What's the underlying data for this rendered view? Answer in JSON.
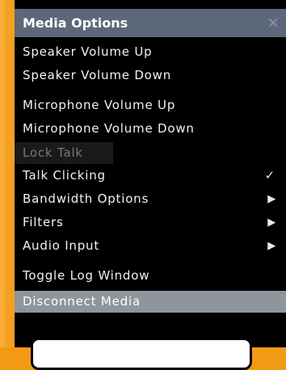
{
  "menu": {
    "title": "Media Options",
    "close_glyph": "×",
    "items": [
      {
        "label": "Speaker Volume Up"
      },
      {
        "label": "Speaker Volume Down"
      },
      {
        "label": "Microphone Volume Up"
      },
      {
        "label": "Microphone Volume Down"
      },
      {
        "label": "Lock Talk",
        "disabled": true
      },
      {
        "label": "Talk Clicking",
        "indicator": "✓"
      },
      {
        "label": "Bandwidth Options",
        "indicator": "▶"
      },
      {
        "label": "Filters",
        "indicator": "▶"
      },
      {
        "label": "Audio Input",
        "indicator": "▶"
      },
      {
        "label": "Toggle Log Window"
      },
      {
        "label": "Disconnect Media",
        "highlighted": true
      }
    ]
  },
  "icons": {
    "close": "close-icon",
    "check": "check-icon",
    "submenu": "submenu-arrow-icon"
  },
  "colors": {
    "background": "#f39a14",
    "menu_bg": "#000000",
    "header_bg": "#5c687a",
    "highlight_bg": "#8e959d"
  }
}
